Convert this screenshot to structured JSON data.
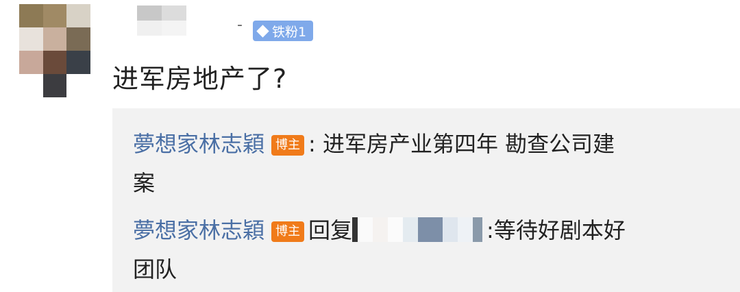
{
  "avatar_colors": [
    "#8d7a55",
    "#a08a65",
    "#d8d2c6",
    "#e8e2dc",
    "#c9b09e",
    "#7a6b55",
    "#c8a89a",
    "#6a4a3a",
    "#3a4048",
    "#ffffff",
    "#3c3c40",
    "#ffffff"
  ],
  "username_colors": [
    "#c8c8c8",
    "#dcdcdc",
    "#f0f0f0",
    "#f4f4f4"
  ],
  "comment": {
    "separator": "-",
    "fan_badge": "铁粉1",
    "text": "进军房地产了?"
  },
  "replies": [
    {
      "author": "夢想家林志穎",
      "badge": "博主",
      "text_line1": ": 进军房产业第四年  勘查公司建",
      "text_line2": "案"
    },
    {
      "author": "夢想家林志穎",
      "badge": "博主",
      "reply_prefix": "回复",
      "text_line1": ":等待好剧本好",
      "text_line2": "团队"
    }
  ],
  "reply_mosaic_colors": [
    "#333333",
    "#fafafa",
    "#f5f2f0",
    "#fbfbfb",
    "#e4ebf0",
    "#7d8fa8",
    "#dfe6ee",
    "#eef2f6",
    "#8a9aaa"
  ],
  "colors": {
    "author": "#4a6fa5",
    "blogger_badge": "#f07b1a",
    "fan_badge": "#7fa9ea",
    "reply_bg": "#f2f2f2"
  }
}
